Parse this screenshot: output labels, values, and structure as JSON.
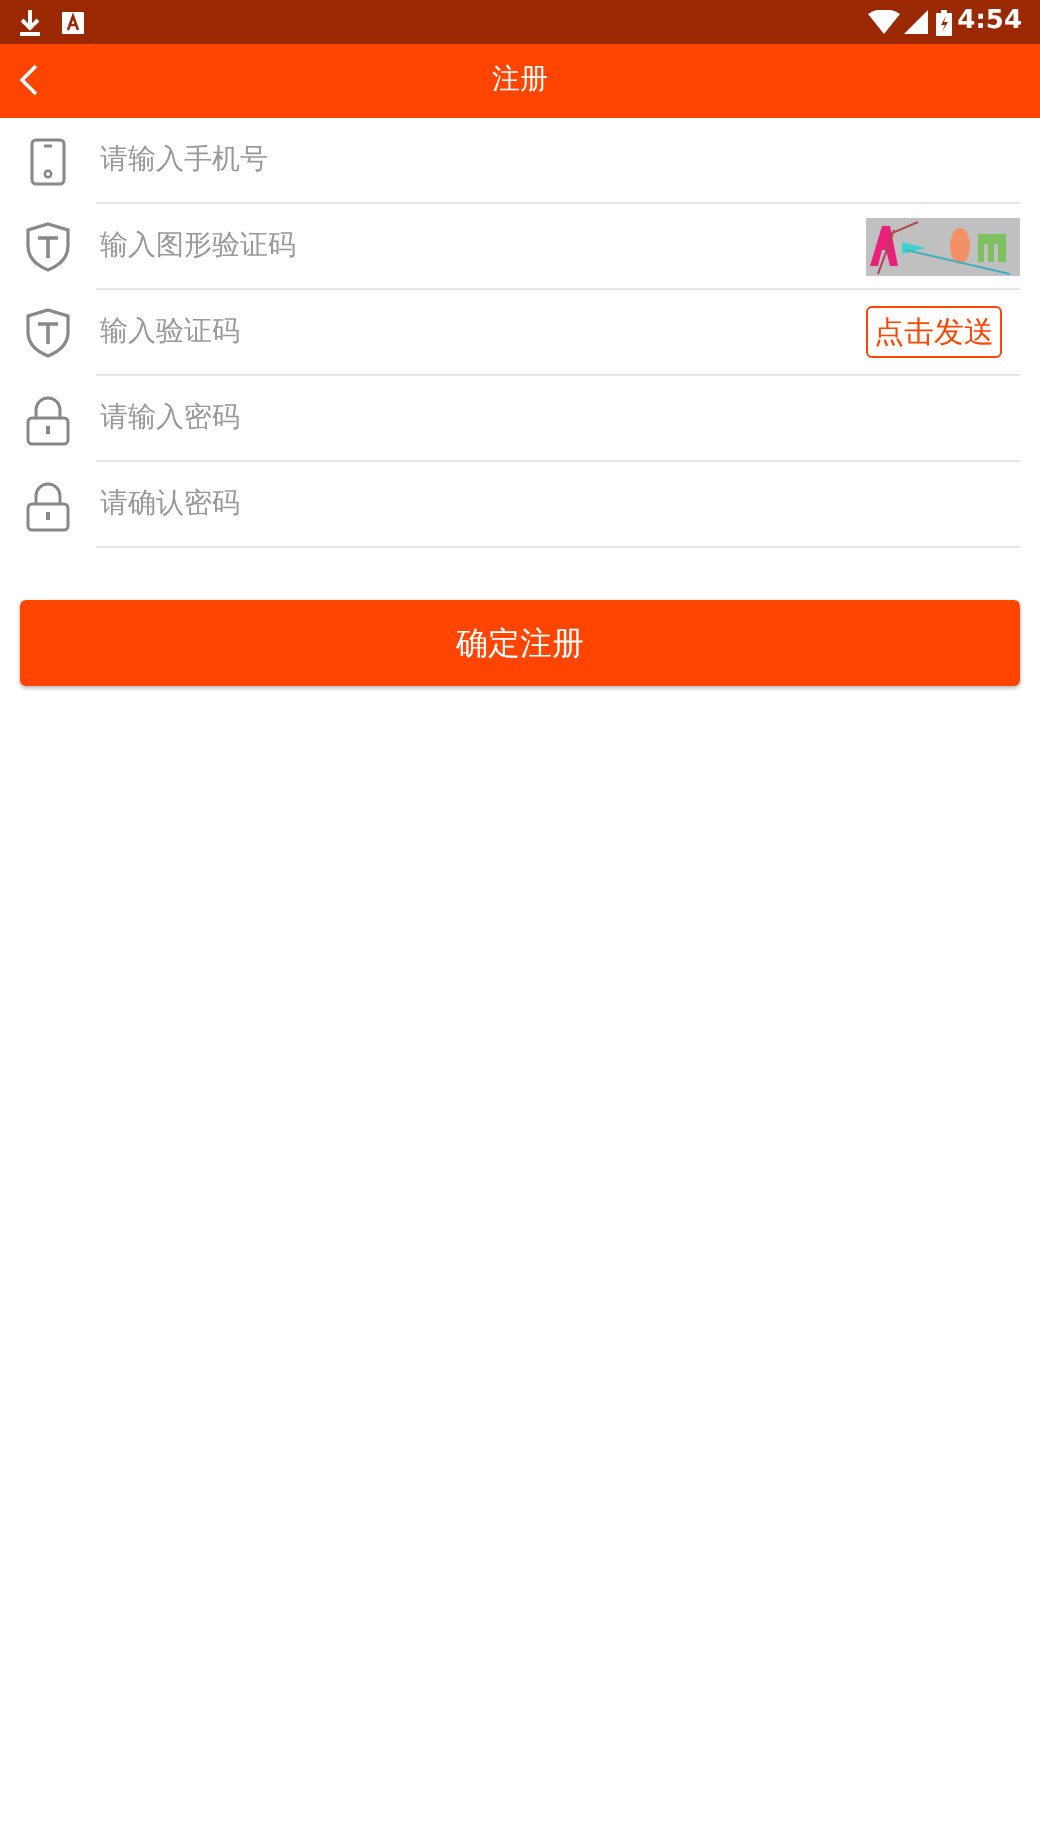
{
  "status_bar": {
    "time": "4:54"
  },
  "header": {
    "title": "注册"
  },
  "fields": [
    {
      "kind": "phone",
      "placeholder": "请输入手机号"
    },
    {
      "kind": "code",
      "placeholder": "输入图形验证码"
    },
    {
      "kind": "code",
      "placeholder": "输入验证码",
      "trailing": {
        "kind": "button",
        "label": "点击发送"
      }
    },
    {
      "kind": "password",
      "placeholder": "请输入密码"
    },
    {
      "kind": "password",
      "placeholder": "请确认密码"
    }
  ],
  "submit": {
    "label": "确定注册"
  }
}
